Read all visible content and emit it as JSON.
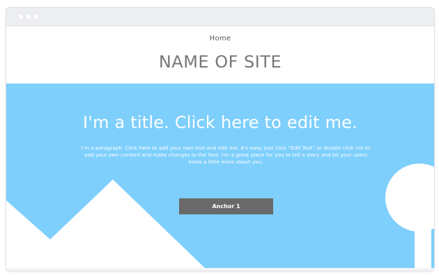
{
  "header": {
    "nav_home": "Home",
    "site_name": "NAME OF SITE"
  },
  "hero": {
    "title": "I'm a title. Click here to edit me.",
    "paragraph": "I'm a paragraph. Click here to add your own text and edit me. It's easy. Just click “Edit Text” or double click me to add your own content and make changes to the font. I'm a great place for you to tell a story and let your users know a little more about you.",
    "button_label": "Anchor 1"
  },
  "colors": {
    "hero_background": "#7ecffc",
    "button_background": "#696969",
    "titlebar": "#eceef1",
    "site_name_text": "#777777"
  },
  "icons": {
    "window_controls": [
      "window-dot-icon",
      "window-dot-icon",
      "window-dot-icon"
    ],
    "decorations": [
      "mountain-shape",
      "tree-shape"
    ]
  }
}
